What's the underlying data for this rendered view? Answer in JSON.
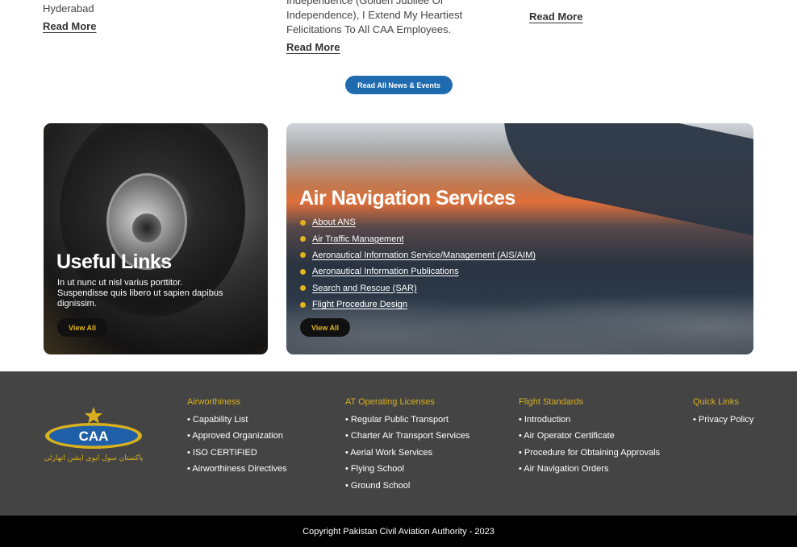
{
  "news": [
    {
      "text": "Hyderabad",
      "read_more": "Read More"
    },
    {
      "text": "Independence (Golden Jubilee Of Independence), I Extend My Heartiest Felicitations To All CAA Employees.",
      "read_more": "Read More"
    },
    {
      "text": "",
      "read_more": "Read More"
    }
  ],
  "news_button": "Read All News & Events",
  "useful_links": {
    "title": "Useful Links",
    "description": "In ut nunc ut nisl varius porttitor. Suspendisse quis libero ut sapien dapibus dignissim.",
    "view_all": "View All"
  },
  "ans": {
    "title": "Air Navigation Services",
    "links": [
      "About ANS",
      "Air Traffic Management",
      "Aeronautical Information Service/Management (AIS/AIM)",
      "Aeronautical Information Publications",
      "Search and Rescue (SAR)",
      "Flight Procedure Design"
    ],
    "view_all": "View All"
  },
  "footer": {
    "logo_text": "CAA",
    "logo_subtext": "پاکستان سول ایوی ایشن اتھارٹی",
    "columns": [
      {
        "heading": "Airworthiness",
        "items": [
          "• Capability List",
          "• Approved Organization",
          "• ISO CERTIFIED",
          "• Airworthiness Directives"
        ]
      },
      {
        "heading": "AT Operating Licenses",
        "items": [
          "• Regular Public Transport",
          "• Charter Air Transport Services",
          "• Aerial Work Services",
          "• Flying School",
          "• Ground School"
        ]
      },
      {
        "heading": "Flight Standards",
        "items": [
          "• Introduction",
          "• Air Operator Certificate",
          "• Procedure for Obtaining Approvals",
          "• Air Navigation Orders"
        ]
      },
      {
        "heading": "Quick Links",
        "items": [
          "• Privacy Policy"
        ]
      }
    ]
  },
  "copyright": "Copyright Pakistan Civil Aviation Authority - 2023",
  "colors": {
    "accent_blue": "#1f6bb0",
    "accent_gold": "#d8b01e",
    "footer_bg": "#444444"
  }
}
